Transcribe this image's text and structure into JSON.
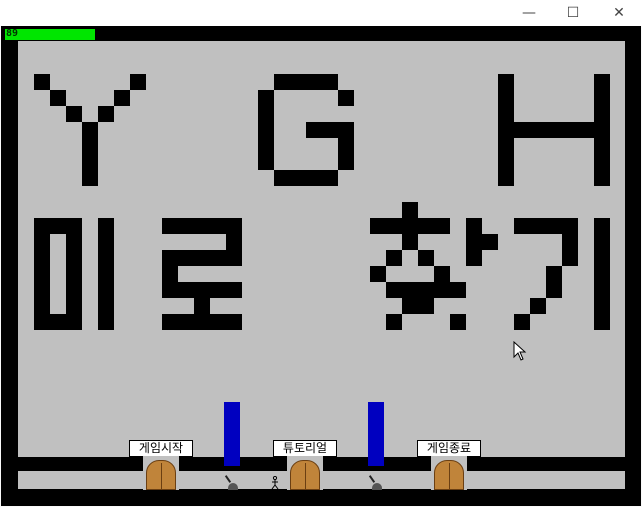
{
  "window": {
    "minimize_glyph": "—",
    "maximize_glyph": "☐",
    "close_glyph": "✕"
  },
  "hud": {
    "hp_value": "89",
    "hp_fraction": 0.89,
    "hp_color": "#00e600"
  },
  "game": {
    "pixel_title": "YGH 미로 찾기",
    "doors": [
      {
        "label": "게임시작"
      },
      {
        "label": "튜토리얼"
      },
      {
        "label": "게임종료"
      }
    ]
  },
  "colors": {
    "wall": "#000000",
    "floor": "#c0c0c0",
    "pillar": "#0000c0",
    "door": "#c0843a"
  }
}
